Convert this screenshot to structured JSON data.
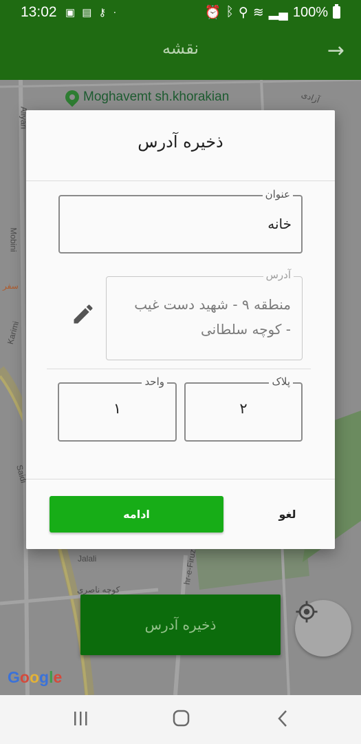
{
  "status_bar": {
    "time": "13:02",
    "battery_pct": "100%"
  },
  "app_bar": {
    "title": "نقشه"
  },
  "map": {
    "poi_name": "Moghavemt sh.khorakian",
    "streets": [
      "Aliyari",
      "Mobini",
      "Karimi",
      "Saidi",
      "Jalali",
      "کوچه ناصری",
      "hr-e-Firuz",
      "آزادی",
      "سفر"
    ],
    "attribution": "Google",
    "save_button_label": "ذخیره آدرس"
  },
  "dialog": {
    "title": "ذخیره آدرس",
    "title_field": {
      "label": "عنوان",
      "value": "خانه"
    },
    "address_field": {
      "label": "آدرس",
      "value": "منطقه ۹ - شهید دست غیب - کوچه سلطانی"
    },
    "plaque_field": {
      "label": "پلاک",
      "value": "۲"
    },
    "unit_field": {
      "label": "واحد",
      "value": "۱"
    },
    "continue_label": "ادامه",
    "cancel_label": "لغو"
  },
  "colors": {
    "app_bar": "#1f6b12",
    "continue_button": "#17ad17",
    "map_save_button": "#0c6c0c"
  }
}
